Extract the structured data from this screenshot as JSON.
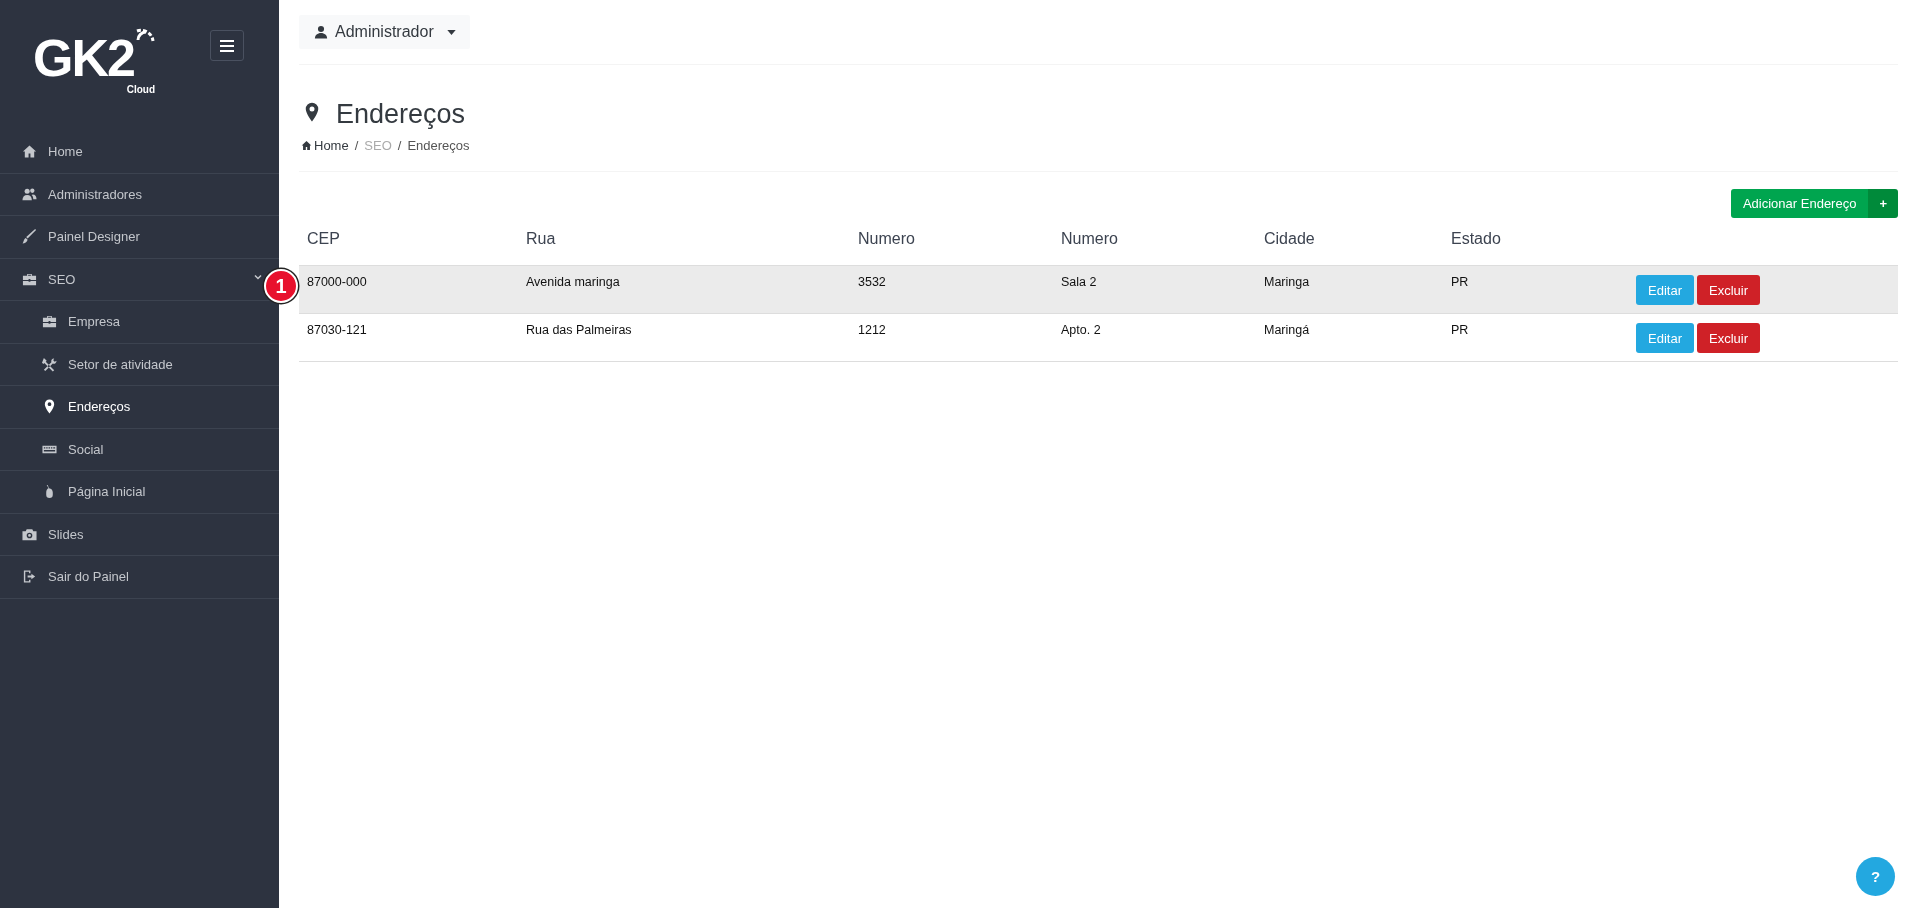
{
  "sidebar": {
    "logo": {
      "text": "GK2",
      "subtext": "Cloud"
    },
    "items": [
      {
        "label": "Home",
        "kind": "home",
        "selected": false
      },
      {
        "label": "Administradores",
        "kind": "users",
        "selected": false
      },
      {
        "label": "Painel Designer",
        "kind": "brush",
        "selected": false
      },
      {
        "label": "SEO",
        "kind": "briefcase",
        "selected": false,
        "expanded": true,
        "children": [
          {
            "label": "Empresa",
            "kind": "briefcase",
            "selected": false
          },
          {
            "label": "Setor de atividade",
            "kind": "tools",
            "selected": false
          },
          {
            "label": "Endereços",
            "kind": "pin",
            "selected": true
          },
          {
            "label": "Social",
            "kind": "keyboard",
            "selected": false
          },
          {
            "label": "Página Inicial",
            "kind": "mouse",
            "selected": false
          }
        ]
      },
      {
        "label": "Slides",
        "kind": "camera",
        "selected": false
      },
      {
        "label": "Sair do Painel",
        "kind": "logout",
        "selected": false
      }
    ]
  },
  "user_menu": {
    "label": "Administrador"
  },
  "page": {
    "title": "Endereços",
    "breadcrumb": [
      {
        "label": "Home",
        "kind": "link"
      },
      {
        "separator": "/",
        "label": "SEO",
        "kind": "muted"
      },
      {
        "separator": "/",
        "label": "Endereços",
        "kind": "current"
      }
    ]
  },
  "add_button": {
    "label": "Adicionar Endereço",
    "icon_text": "+"
  },
  "table": {
    "columns": [
      "CEP",
      "Rua",
      "Numero",
      "Numero",
      "Cidade",
      "Estado"
    ],
    "rows": [
      {
        "cells": [
          "87000-000",
          "Avenida maringa",
          "3532",
          "Sala 2",
          "Maringa",
          "PR"
        ],
        "selected": true,
        "actions": [
          "Editar",
          "Excluir"
        ]
      },
      {
        "cells": [
          "87030-121",
          "Rua das Palmeiras",
          "1212",
          "Apto. 2",
          "Maringá",
          "PR"
        ],
        "selected": false,
        "actions": [
          "Editar",
          "Excluir"
        ]
      }
    ]
  },
  "step_marker": "1",
  "help_button": "?"
}
